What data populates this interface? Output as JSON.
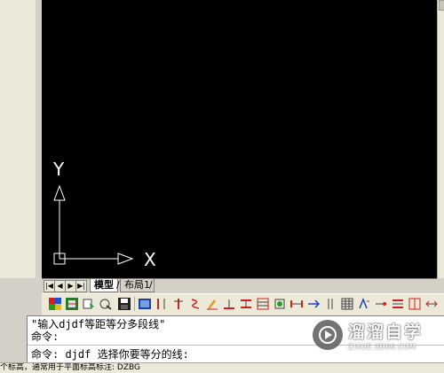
{
  "canvas": {
    "ucs": {
      "y_label": "Y",
      "x_label": "X"
    }
  },
  "tabs": {
    "items": [
      {
        "label": "模型",
        "active": true
      },
      {
        "label": "布局1",
        "active": false
      }
    ],
    "nav_icons": [
      "first-tab-icon",
      "prev-tab-icon",
      "next-tab-icon",
      "last-tab-icon"
    ]
  },
  "toolbar": {
    "buttons": [
      "tool-a-icon",
      "tool-b-icon",
      "tool-c-icon",
      "tool-d-icon",
      "save-icon",
      "tool-f-icon",
      "tool-g-icon",
      "tool-h-icon",
      "tool-i-icon",
      "tool-j-icon",
      "tool-k-icon",
      "tool-l-icon",
      "tool-m-icon",
      "tool-n-icon",
      "tool-o-icon",
      "tool-p-icon",
      "tool-q-icon",
      "tool-r-icon",
      "tool-s-icon",
      "tool-t-icon",
      "tool-u-icon",
      "tool-v-icon",
      "tool-w-icon",
      "tool-x-icon"
    ]
  },
  "command": {
    "line1": "\"输入djdf等距等分多段线\"",
    "line2": "命令:",
    "line3": "命令: djdf 选择你要等分的线:"
  },
  "status": {
    "text": "个标高，通常用于平面标高标注: DZBG"
  },
  "watermark": {
    "title": "溜溜自学",
    "subtitle": "ZIXUE.3D66.COM"
  }
}
